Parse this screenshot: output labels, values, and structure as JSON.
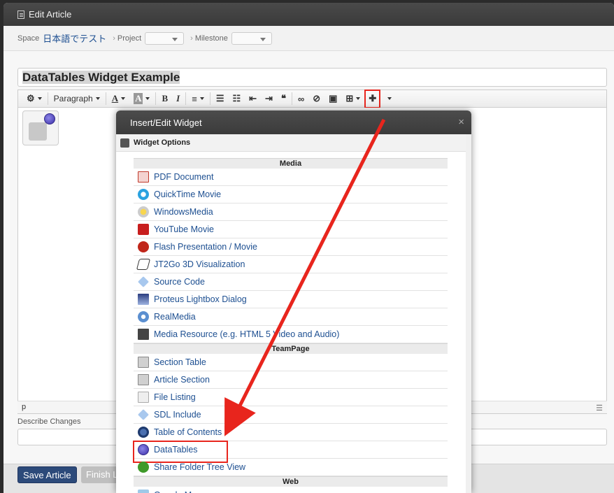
{
  "window": {
    "title": "Edit Article"
  },
  "breadcrumb": {
    "space_label": "Space",
    "space_name": "日本語でテスト",
    "project_label": "Project",
    "milestone_label": "Milestone"
  },
  "article": {
    "title": "DataTables Widget Example"
  },
  "toolbar": {
    "paragraph_label": "Paragraph"
  },
  "editor": {
    "status_path": "p"
  },
  "describe": {
    "label": "Describe Changes"
  },
  "footer": {
    "save_label": "Save Article",
    "finish_label": "Finish L"
  },
  "dialog": {
    "title": "Insert/Edit Widget",
    "close_glyph": "×",
    "options_label": "Widget Options",
    "groups": [
      {
        "name": "Media",
        "items": [
          {
            "label": "PDF Document",
            "icon": "pdf-icon"
          },
          {
            "label": "QuickTime Movie",
            "icon": "quicktime-icon"
          },
          {
            "label": "WindowsMedia",
            "icon": "windows-media-icon"
          },
          {
            "label": "YouTube Movie",
            "icon": "youtube-icon"
          },
          {
            "label": "Flash Presentation / Movie",
            "icon": "flash-icon"
          },
          {
            "label": "JT2Go 3D Visualization",
            "icon": "jt2go-icon"
          },
          {
            "label": "Source Code",
            "icon": "source-code-icon"
          },
          {
            "label": "Proteus Lightbox Dialog",
            "icon": "lightbox-icon"
          },
          {
            "label": "RealMedia",
            "icon": "realmedia-icon"
          },
          {
            "label": "Media Resource (e.g. HTML 5 Video and Audio)",
            "icon": "media-resource-icon"
          }
        ]
      },
      {
        "name": "TeamPage",
        "items": [
          {
            "label": "Section Table",
            "icon": "section-table-icon"
          },
          {
            "label": "Article Section",
            "icon": "article-section-icon"
          },
          {
            "label": "File Listing",
            "icon": "file-listing-icon"
          },
          {
            "label": "SDL Include",
            "icon": "sdl-include-icon"
          },
          {
            "label": "Table of Contents",
            "icon": "toc-icon"
          },
          {
            "label": "DataTables",
            "icon": "datatables-icon"
          },
          {
            "label": "Share Folder Tree View",
            "icon": "tree-view-icon"
          }
        ]
      },
      {
        "name": "Web",
        "items": [
          {
            "label": "Google Map",
            "icon": "google-map-icon"
          }
        ]
      }
    ]
  },
  "highlight_color": "#e8251d"
}
